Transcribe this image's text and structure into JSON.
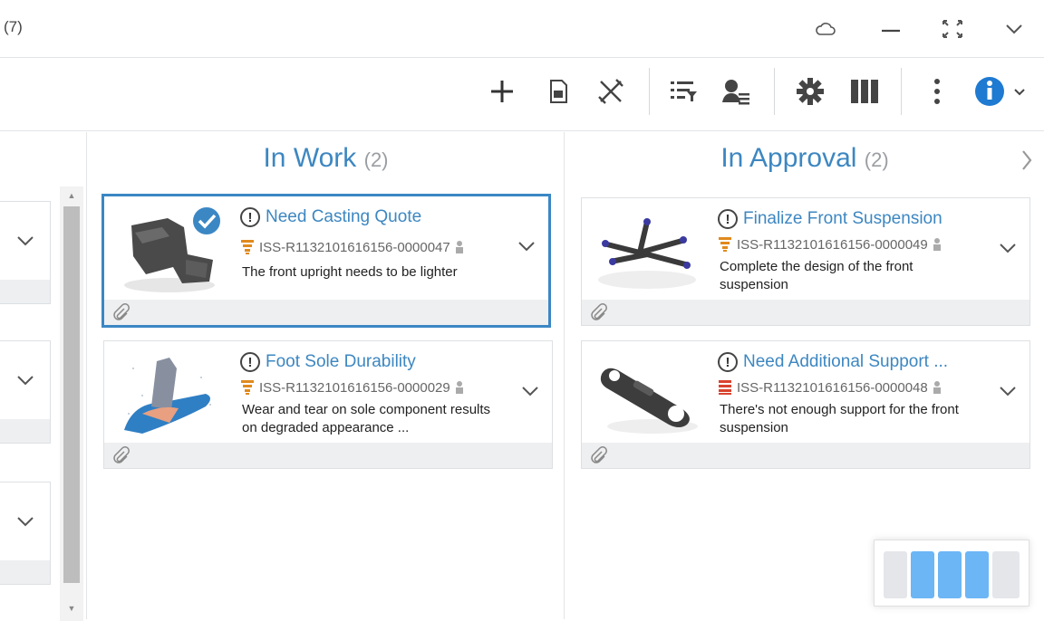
{
  "window": {
    "title_count": "(7)"
  },
  "columns": {
    "in_work": {
      "title": "In Work",
      "count": "(2)"
    },
    "in_approval": {
      "title": "In Approval",
      "count": "(2)"
    }
  },
  "cards": {
    "c1": {
      "title": "Need Casting Quote",
      "id": "ISS-R1132101616156-0000047",
      "desc": "The front upright needs to be lighter",
      "priority_color": "#e08a1e"
    },
    "c2": {
      "title": "Foot Sole Durability",
      "id": "ISS-R1132101616156-0000029",
      "desc": "Wear and tear on sole component results on degraded appearance ...",
      "priority_color": "#e08a1e"
    },
    "c3": {
      "title": "Finalize Front Suspension",
      "id": "ISS-R1132101616156-0000049",
      "desc": "Complete the design of the front suspension",
      "priority_color": "#e08a1e"
    },
    "c4": {
      "title": "Need Additional Support ...",
      "id": "ISS-R1132101616156-0000048",
      "desc": "There's not enough support for the front suspension",
      "priority_color": "#d9432f"
    }
  },
  "colors": {
    "accent": "#3d87c1",
    "selected_border": "#3b87c4",
    "info_blue": "#1f7ad1",
    "minimap_active": "#6cb6f5",
    "minimap_inactive": "#e4e6ea"
  },
  "icons": [
    "cloud-icon",
    "minimize-icon",
    "fullscreen-icon",
    "chevron-down-icon",
    "add-icon",
    "export-icon",
    "tools-icon",
    "filter-list-icon",
    "owner-filter-icon",
    "settings-icon",
    "columns-icon",
    "more-icon",
    "info-icon",
    "paperclip-icon",
    "check-icon"
  ]
}
